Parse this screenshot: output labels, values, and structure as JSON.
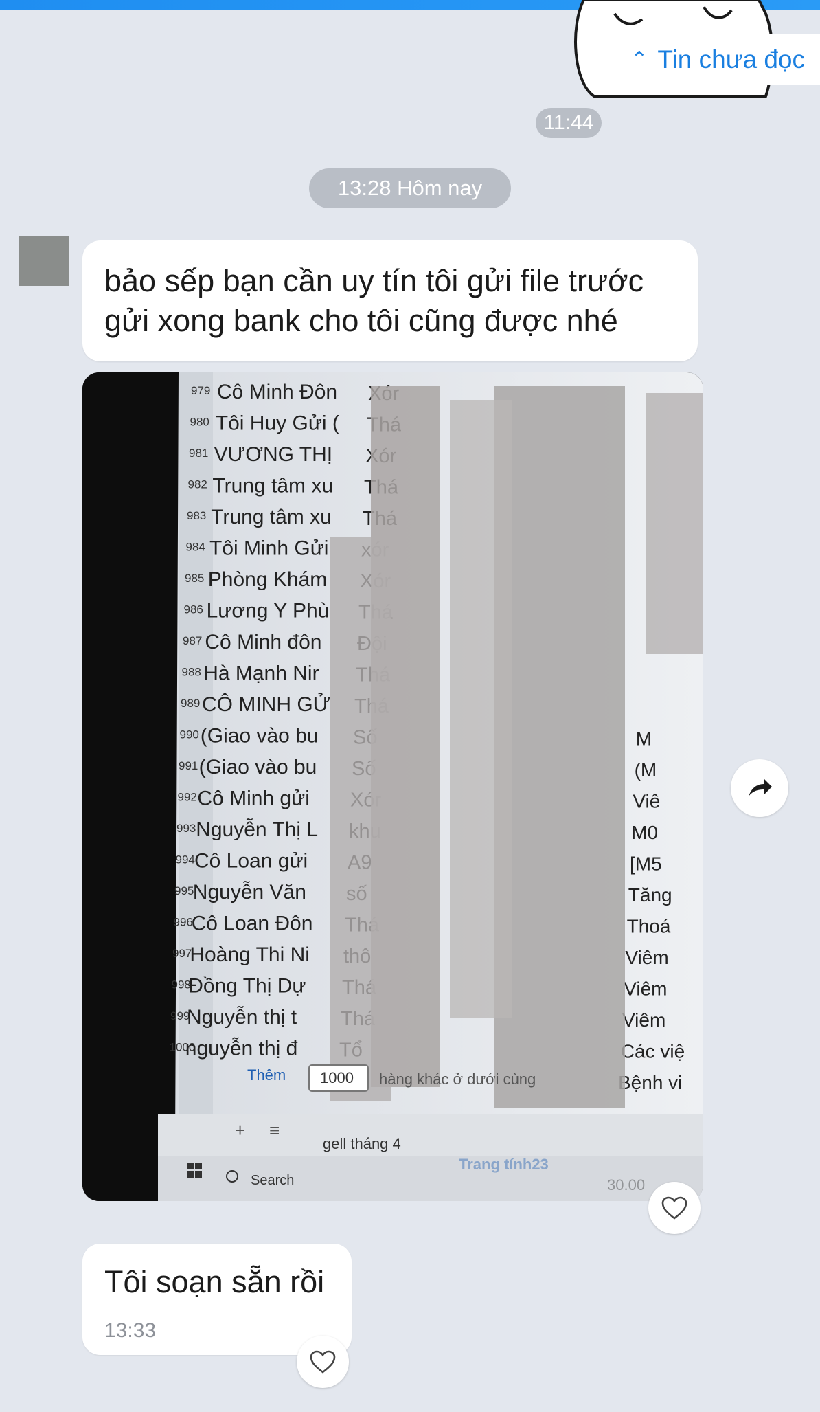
{
  "header": {
    "unread_label": "Tin chưa đọc",
    "unread_icon": "double-chevron-up-icon"
  },
  "timestamps": {
    "top": "11:44",
    "divider": "13:28 Hôm nay"
  },
  "messages": [
    {
      "text_line1": "bảo sếp bạn cần uy tín tôi gửi file trước",
      "text_line2": "gửi xong bank cho tôi cũng được nhé"
    },
    {
      "text": "Tôi soạn sẵn rồi",
      "time": "13:33"
    }
  ],
  "photo": {
    "row_numbers": [
      "979",
      "980",
      "981",
      "982",
      "983",
      "984",
      "985",
      "986",
      "987",
      "988",
      "989",
      "990",
      "991",
      "992",
      "993",
      "994",
      "995",
      "996",
      "997",
      "998",
      "999",
      "1000"
    ],
    "names": [
      "Cô Minh Đôn",
      "Tôi Huy Gửi (",
      "VƯƠNG THỊ",
      "Trung tâm xu",
      "Trung tâm xu",
      "Tôi Minh Gửi",
      "Phòng Khám",
      "Lương Y Phù",
      "Cô Minh đôn",
      "Hà Mạnh Nir",
      "CÔ MINH GỬ",
      "(Giao vào bu",
      "(Giao vào bu",
      "Cô Minh gửi",
      "Nguyễn Thị L",
      "Cô Loan gửi",
      "Nguyễn Văn",
      "Cô Loan Đôn",
      "Hoàng Thi Ni",
      "Đồng Thị Dự",
      "Nguyễn thị t",
      "nguyễn thị đ"
    ],
    "col3": [
      "Xór",
      "Thá",
      "Xór",
      "Thá",
      "Thá",
      "xór",
      "Xór",
      "Thá",
      "Đội",
      "Thá",
      "Thá",
      "Số",
      "Số",
      "Xór",
      "khu",
      "A9",
      "số",
      "Thá",
      "thô",
      "Thá",
      "Thá",
      "Tổ"
    ],
    "col5": [
      "",
      "",
      "",
      "",
      "",
      "",
      "",
      "",
      "",
      "",
      "",
      "",
      "",
      "",
      "",
      "",
      "",
      "",
      "",
      "",
      "",
      ""
    ],
    "col6": [
      "",
      "",
      "",
      "",
      "",
      "",
      "",
      "",
      "",
      "",
      "",
      "M",
      "(M",
      "Viê",
      "M0",
      "[M5",
      "Tăng",
      "Thoá",
      "Viêm",
      "Viêm",
      "Viêm",
      "Các việ"
    ],
    "col6_extra": "Bệnh vi",
    "footer_more_label": "Thêm",
    "footer_count": "1000",
    "footer_hint": "hàng khác ở dưới cùng",
    "sheet_tab_1": "gell tháng 4",
    "sheet_tab_2": "Trang tính23",
    "search_label": "Search",
    "right_value": "30.00"
  },
  "icons": {
    "share": "share-arrow-icon",
    "heart": "heart-icon"
  },
  "colors": {
    "background": "#e3e7ee",
    "accent": "#1a7fe0",
    "pill": "#b9bec6"
  }
}
